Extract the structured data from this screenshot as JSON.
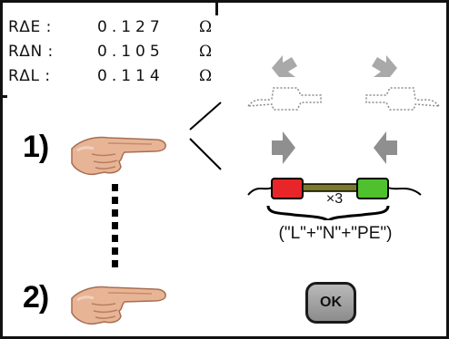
{
  "readings": [
    {
      "label": "RΔE :",
      "value": "0.127",
      "unit": "Ω"
    },
    {
      "label": "RΔN :",
      "value": "0.105",
      "unit": "Ω"
    },
    {
      "label": "RΔL :",
      "value": "0.114",
      "unit": "Ω"
    }
  ],
  "steps": {
    "step1_label": "1)",
    "step2_label": "2)"
  },
  "diagram": {
    "multiplier": "×3",
    "conductors": "(\"L\"+\"N\"+\"PE\")",
    "left_plug_color": "#e8262a",
    "right_plug_color": "#4fc12f"
  },
  "ok_button": {
    "label": "OK"
  }
}
